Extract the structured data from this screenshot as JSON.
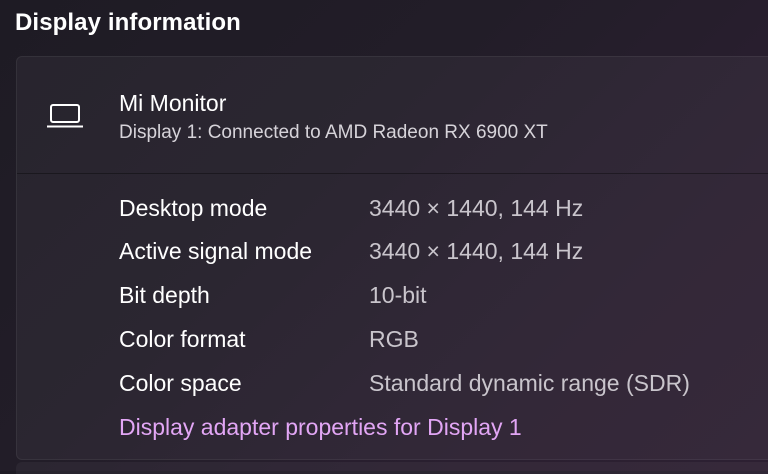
{
  "section": {
    "title": "Display information"
  },
  "monitor": {
    "name": "Mi Monitor",
    "subtitle": "Display 1: Connected to AMD Radeon RX 6900 XT",
    "icon": "laptop-icon"
  },
  "details": [
    {
      "label": "Desktop mode",
      "value": "3440 × 1440, 144 Hz"
    },
    {
      "label": "Active signal mode",
      "value": "3440 × 1440, 144 Hz"
    },
    {
      "label": "Bit depth",
      "value": "10-bit"
    },
    {
      "label": "Color format",
      "value": "RGB"
    },
    {
      "label": "Color space",
      "value": "Standard dynamic range (SDR)"
    }
  ],
  "adapter_link": "Display adapter properties for Display 1",
  "colors": {
    "accent_link": "#e2a6f5",
    "background": "#221d28"
  }
}
